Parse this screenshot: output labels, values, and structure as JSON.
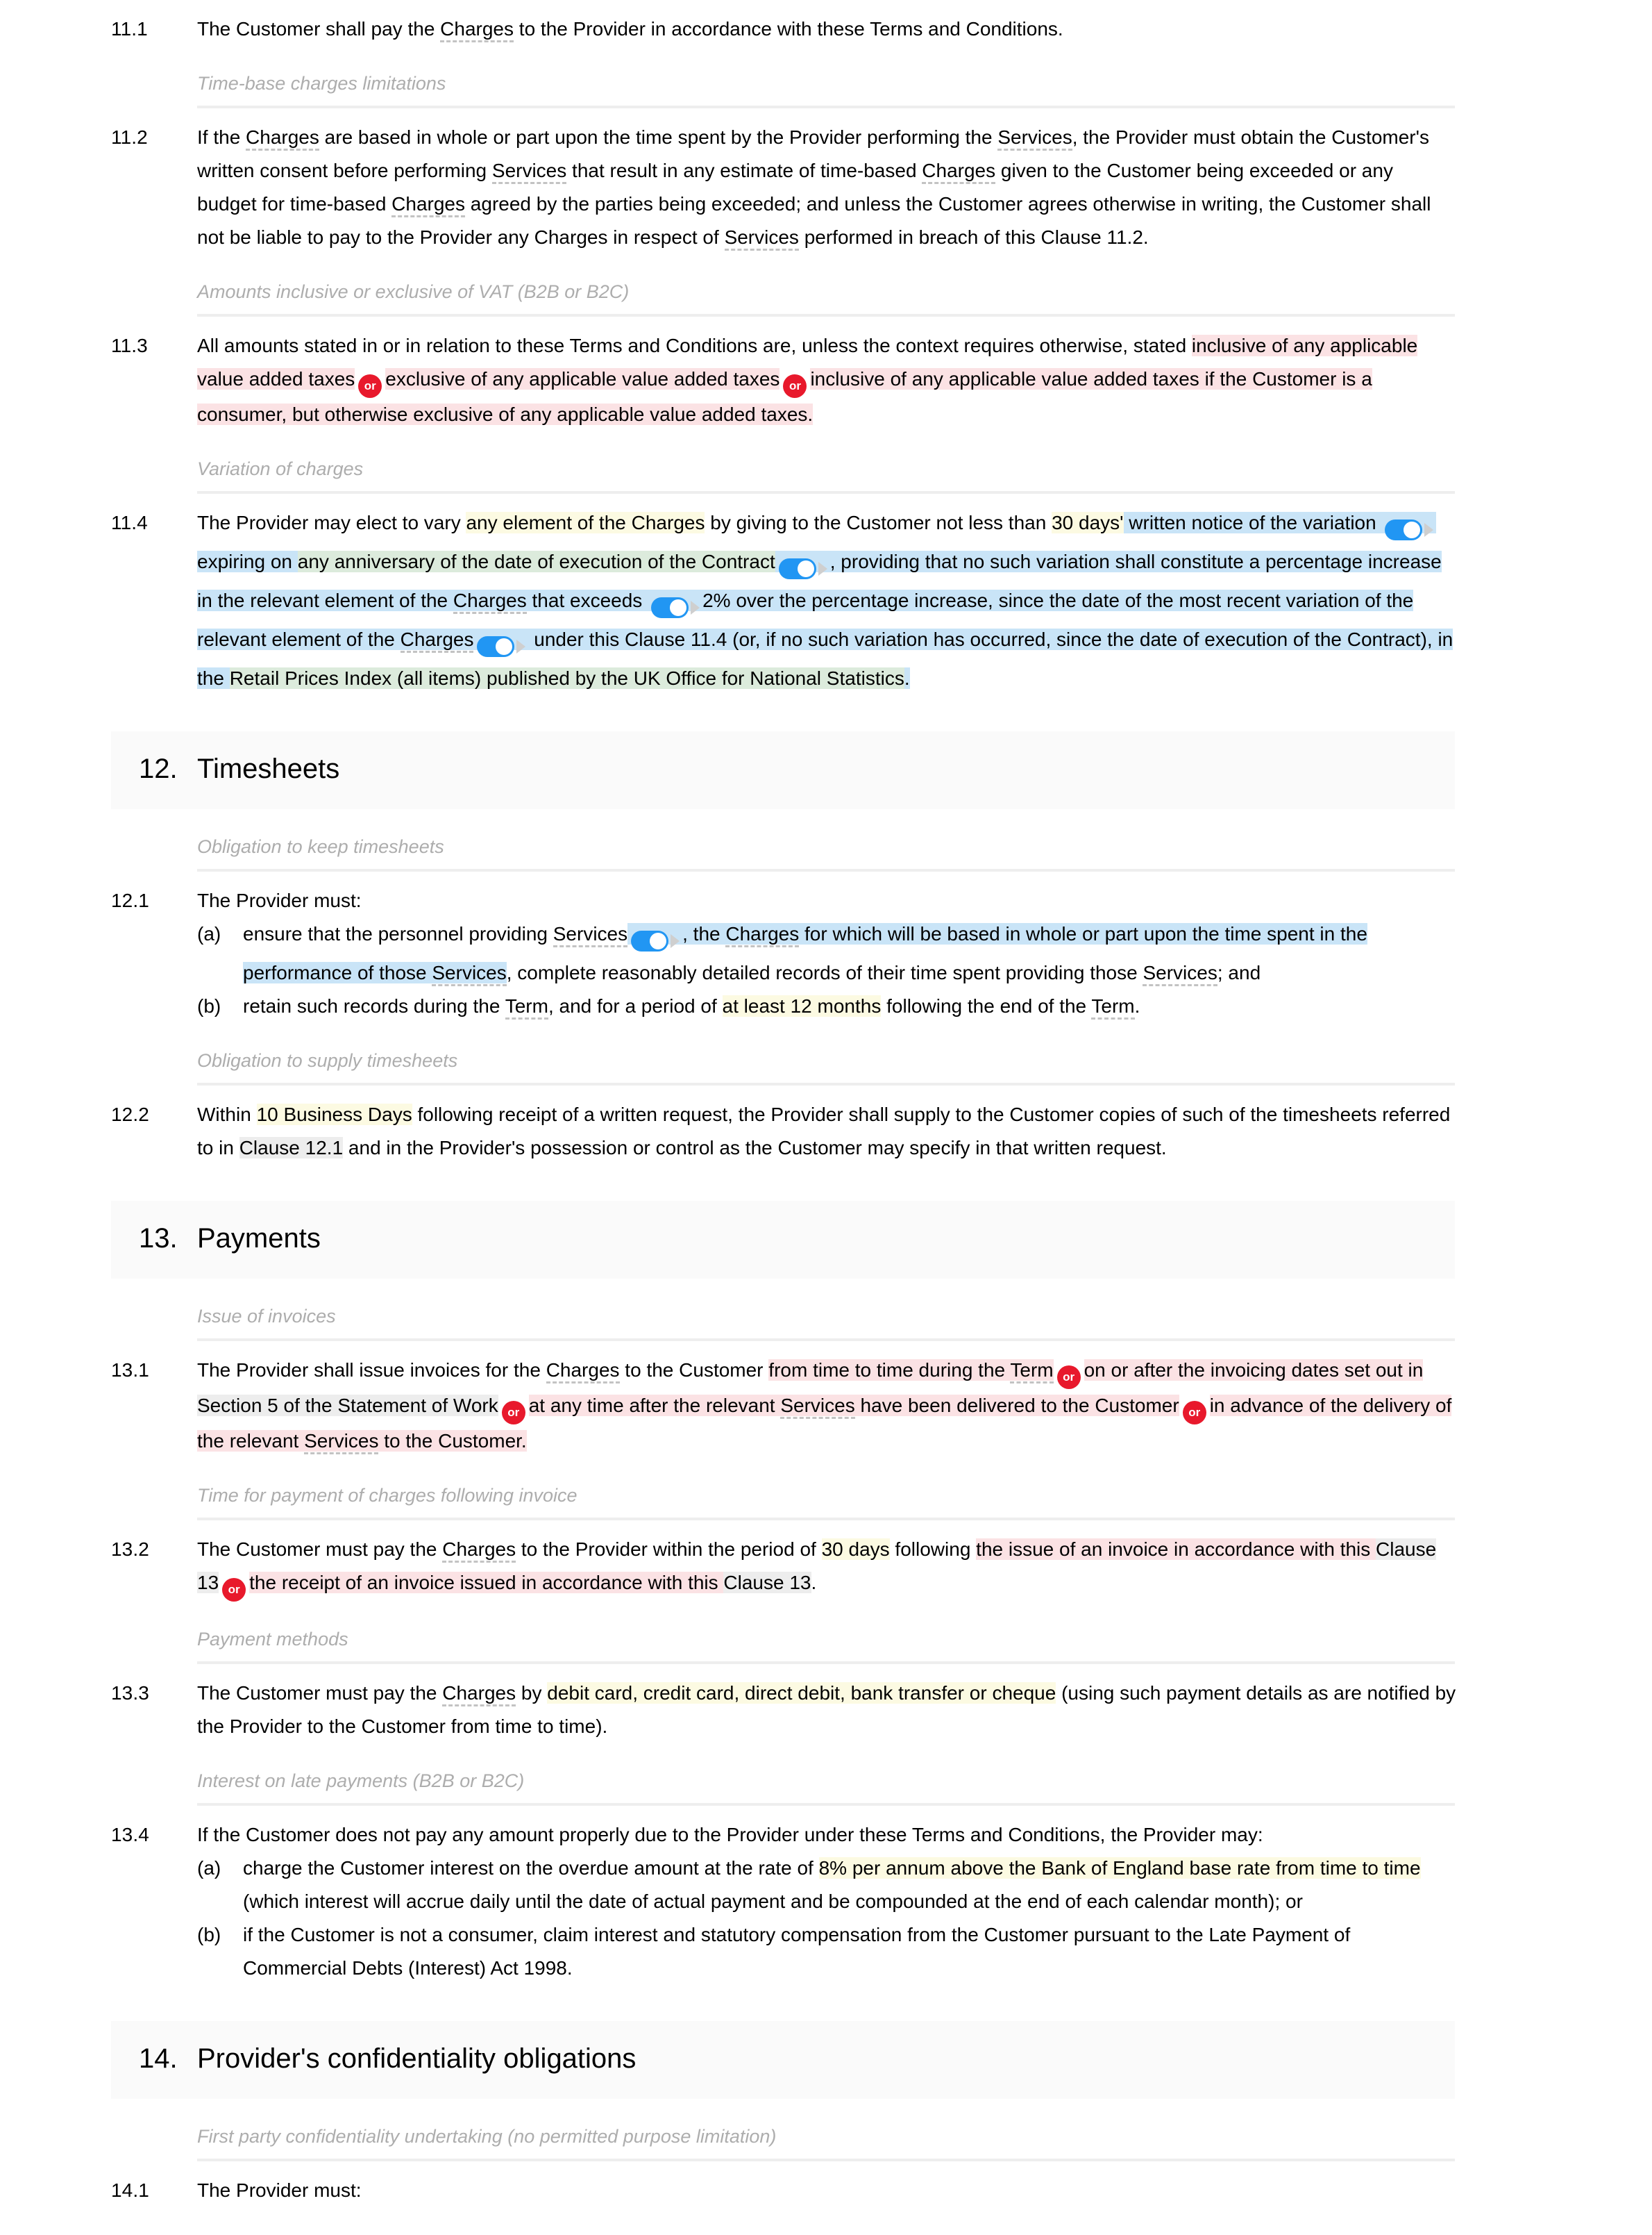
{
  "doc": {
    "colors": {
      "highlight_pink": "#fbe2e4",
      "highlight_yellow": "#fcfae2",
      "highlight_blue": "#c9e4f7",
      "highlight_green": "#dcebdc",
      "highlight_grey": "#ededed",
      "or_badge_red": "#e8192c",
      "toggle_blue": "#2196f3",
      "section_band": "#fafafa",
      "subheading_grey": "#adadad"
    },
    "or_label": "or"
  },
  "c11_1": {
    "num": "11.1",
    "t1": "The Customer shall pay the ",
    "term_charges": "Charges",
    "t2": " to the Provider in accordance with these Terms and Conditions."
  },
  "sub_time_base": {
    "text": "Time-base charges limitations"
  },
  "c11_2": {
    "num": "11.2",
    "t1": "If the ",
    "term_charges_a": "Charges",
    "t2": " are based in whole or part upon the time spent by the Provider performing the ",
    "term_services_a": "Services",
    "t3": ", the Provider must obtain the Customer's written consent before performing ",
    "term_services_b": "Services",
    "t4": " that result in any estimate of time-based ",
    "term_charges_b": "Charges",
    "t5": " given to the Customer being exceeded or any budget for time-based ",
    "term_charges_c": "Charges",
    "t6": " agreed by the parties being exceeded; and unless the Customer agrees otherwise in writing, the Customer shall not be liable to pay to the Provider any Charges in respect of ",
    "term_services_c": "Services",
    "t7": " performed in breach of this Clause 11.2."
  },
  "sub_vat": {
    "text": "Amounts inclusive or exclusive of VAT (B2B or B2C)"
  },
  "c11_3": {
    "num": "11.3",
    "t1": "All amounts stated in or in relation to these Terms and Conditions are, unless the context requires otherwise, stated ",
    "opt1": "inclusive of any applicable value added taxes",
    "opt2": "exclusive of any applicable value added taxes",
    "opt3": "inclusive of any applicable value added taxes if the Customer is a consumer, but otherwise exclusive of any applicable value added taxes."
  },
  "sub_variation": {
    "text": "Variation of charges"
  },
  "c11_4": {
    "num": "11.4",
    "t1": "The Provider may elect to vary ",
    "hl_any_element": "any element of the Charges",
    "t2": " by giving to the Customer not less than ",
    "hl_30days": "30 days'",
    "t3": " written notice of the variation ",
    "t4": " expiring on ",
    "hl_anniversary": "any anniversary of the date of execution of the Contract",
    "t5": ", providing that no such variation shall constitute a percentage increase in the relevant element of the ",
    "term_charges_a": "Charges",
    "t6": " that exceeds ",
    "hl_2pct": "2% over",
    "t7": " the percentage increase, since the date of the most recent variation of the relevant element of the ",
    "term_charges_b": "Charges",
    "t8": " under this Clause 11.4 (or, if no such variation has occurred, since the date of execution of the Contract), in the ",
    "hl_rpi": "Retail Prices Index (all items) published by the UK Office for National Statistics",
    "t9": "."
  },
  "s12": {
    "num": "12.",
    "title": "Timesheets"
  },
  "sub_keep_timesheets": {
    "text": "Obligation to keep timesheets"
  },
  "c12_1": {
    "num": "12.1",
    "intro": "The Provider must:",
    "a_label": "(a)",
    "a_t1": "ensure that the personnel providing ",
    "a_term_services_a": "Services",
    "a_t2": ", the ",
    "a_term_charges": "Charges",
    "a_t3": " for which will be based in whole or part upon the time spent in the performance of those ",
    "a_term_services_b": "Services",
    "a_t4": ", complete reasonably detailed records of their time spent providing those ",
    "a_term_services_c": "Services",
    "a_t5": "; and",
    "b_label": "(b)",
    "b_t1": "retain such records during the ",
    "b_term_term_a": "Term",
    "b_t2": ", and for a period of ",
    "b_hl_12months": "at least 12 months",
    "b_t3": " following the end of the ",
    "b_term_term_b": "Term",
    "b_t4": "."
  },
  "sub_supply_timesheets": {
    "text": "Obligation to supply timesheets"
  },
  "c12_2": {
    "num": "12.2",
    "t1": "Within ",
    "hl_10bd": "10 Business Days",
    "t2": " following receipt of a written request, the Provider shall supply to the Customer copies of such of the timesheets referred to in ",
    "xref_clause": "Clause 12.1",
    "t3": " and in the Provider's possession or control as the Customer may specify in that written request."
  },
  "s13": {
    "num": "13.",
    "title": "Payments"
  },
  "sub_issue_invoices": {
    "text": "Issue of invoices"
  },
  "c13_1": {
    "num": "13.1",
    "t1": "The Provider shall issue invoices for the ",
    "term_charges": "Charges",
    "t2": " to the Customer ",
    "opt1_a": "from time to time during the ",
    "opt1_term": "Term",
    "opt2_a": "on or after the invoicing dates set out in ",
    "opt2_xref": "Section 5 of the Statement of Work",
    "opt3_a": "at any time after the relevant ",
    "opt3_term": "Services",
    "opt3_b": " have been delivered to the Customer",
    "opt4_a": "in advance of the delivery of the relevant ",
    "opt4_term": "Services",
    "opt4_b": " to the Customer."
  },
  "sub_time_payment": {
    "text": "Time for payment of charges following invoice"
  },
  "c13_2": {
    "num": "13.2",
    "t1": "The Customer must pay the ",
    "term_charges": "Charges",
    "t2": " to the Provider within the period of ",
    "hl_30days": "30 days",
    "t3": " following ",
    "opt1_a": "the issue of an invoice in accordance with this ",
    "opt1_xref": "Clause 13",
    "opt2_a": "the receipt of an invoice issued in accordance with this ",
    "opt2_xref": "Clause 13",
    "opt2_b": "."
  },
  "sub_payment_methods": {
    "text": "Payment methods"
  },
  "c13_3": {
    "num": "13.3",
    "t1": "The Customer must pay the ",
    "term_charges": "Charges",
    "t2": " by ",
    "hl_methods": "debit card, credit card, direct debit, bank transfer or cheque",
    "t3": " (using such payment details as are notified by the Provider to the Customer from time to time)."
  },
  "sub_interest": {
    "text": "Interest on late payments (B2B or B2C)"
  },
  "c13_4": {
    "num": "13.4",
    "intro": "If the Customer does not pay any amount properly due to the Provider under these Terms and Conditions, the Provider may:",
    "a_label": "(a)",
    "a_t1": "charge the Customer interest on the overdue amount at the rate of ",
    "a_hl_rate": "8% per annum above the Bank of England base rate from time to time",
    "a_t2": " (which interest will accrue daily until the date of actual payment and be compounded at the end of each calendar month); or",
    "b_label": "(b)",
    "b_t1": "if the Customer is not a consumer, claim interest and statutory compensation from the Customer pursuant to the Late Payment of Commercial Debts (Interest) Act 1998."
  },
  "s14": {
    "num": "14.",
    "title": "Provider's confidentiality obligations"
  },
  "sub_first_party": {
    "text": "First party confidentiality undertaking (no permitted purpose limitation)"
  },
  "c14_1": {
    "num": "14.1",
    "intro": "The Provider must:"
  }
}
